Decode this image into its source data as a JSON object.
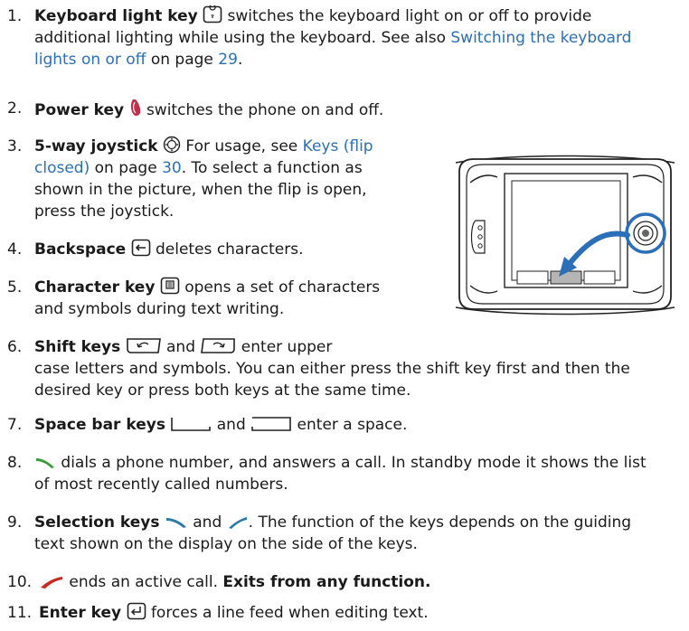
{
  "items": [
    {
      "num": "1.",
      "term": "Keyboard light key",
      "text1": " switches the keyboard light on or off to provide",
      "text2": "additional lighting while using the keyboard. See also ",
      "link1": "Switching the keyboard",
      "link2": "lights on or off",
      "text3": " on page ",
      "page": "29",
      "text4": "."
    },
    {
      "num": "2.",
      "term": "Power key",
      "text1": " switches the phone on and off."
    },
    {
      "num": "3.",
      "term": "5-way joystick",
      "text1": " For usage, see ",
      "link1": "Keys (flip",
      "link2": "closed)",
      "text2": " on page ",
      "page": "30",
      "text3": ". To select a function as",
      "line3": "shown in the picture, when the flip is open,",
      "line4": "press the joystick."
    },
    {
      "num": "4.",
      "term": "Backspace",
      "text1": " deletes characters."
    },
    {
      "num": "5.",
      "term": "Character key",
      "text1": " opens a set of characters",
      "line2": "and symbols during text writing."
    },
    {
      "num": "6.",
      "term": "Shift keys",
      "and": " and ",
      "text1": " enter upper",
      "line2": "case letters and symbols. You can either press the shift key first and then the",
      "line3": "desired key or press both keys at the same time."
    },
    {
      "num": "7.",
      "term": "Space bar keys",
      "and": " and ",
      "text1": " enter a space."
    },
    {
      "num": "8.",
      "text1": " dials a phone number, and answers a call. In standby mode it shows the list",
      "line2": "of most recently called numbers."
    },
    {
      "num": "9.",
      "term": "Selection keys",
      "and": " and ",
      "text1": ". The function of the keys depends on the guiding",
      "line2": "text shown on the display on the side of the keys."
    },
    {
      "num": "10.",
      "text1": " ends an active call. ",
      "bold": "Exits from any function."
    },
    {
      "num": "11.",
      "term": "Enter key",
      "text1": " forces a line feed when editing text."
    }
  ],
  "colors": {
    "link": "#2a6fb8",
    "power_icon": "#c0304a",
    "call_icon": "#3a9a3a",
    "end_icon": "#c62a1e",
    "select_icon": "#2a7aa8"
  },
  "icons": [
    "keyboard-light-icon",
    "power-icon",
    "joystick-icon",
    "backspace-icon",
    "character-key-icon",
    "shift-left-icon",
    "shift-right-icon",
    "space-left-icon",
    "space-right-icon",
    "call-icon",
    "selection-left-icon",
    "selection-right-icon",
    "end-call-icon",
    "enter-icon"
  ]
}
